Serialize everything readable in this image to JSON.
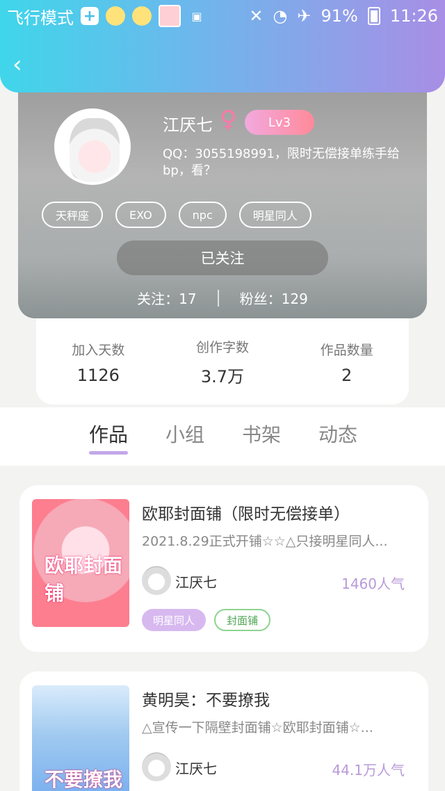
{
  "status": {
    "mode_text": "飞行模式",
    "battery": "91%",
    "time": "11:26"
  },
  "profile": {
    "name": "江厌七",
    "gender_symbol": "♀",
    "level": "Lv3",
    "bio": "QQ：3055198991，限时无偿接单练手给bp，看？",
    "tags": [
      "天秤座",
      "EXO",
      "npc",
      "明星同人"
    ],
    "follow_state": "已关注",
    "following_label": "关注：",
    "following_count": "17",
    "fans_label": "粉丝：",
    "fans_count": "129"
  },
  "stats": [
    {
      "label": "加入天数",
      "value": "1126"
    },
    {
      "label": "创作字数",
      "value": "3.7万"
    },
    {
      "label": "作品数量",
      "value": "2"
    }
  ],
  "tabs": [
    "作品",
    "小组",
    "书架",
    "动态"
  ],
  "works": [
    {
      "title": "欧耶封面铺（限时无偿接单）",
      "desc": "2021.8.29正式开铺☆☆△只接明星同人...",
      "author": "江厌七",
      "popularity": "1460人气",
      "cover_text": "欧耶封面铺",
      "tags": [
        "明星同人",
        "封面铺"
      ]
    },
    {
      "title": "黄明昊：不要撩我",
      "desc": "△宣传一下隔壁封面铺☆欧耶封面铺☆...",
      "author": "江厌七",
      "popularity": "44.1万人气",
      "cover_text": "不要撩我"
    }
  ]
}
